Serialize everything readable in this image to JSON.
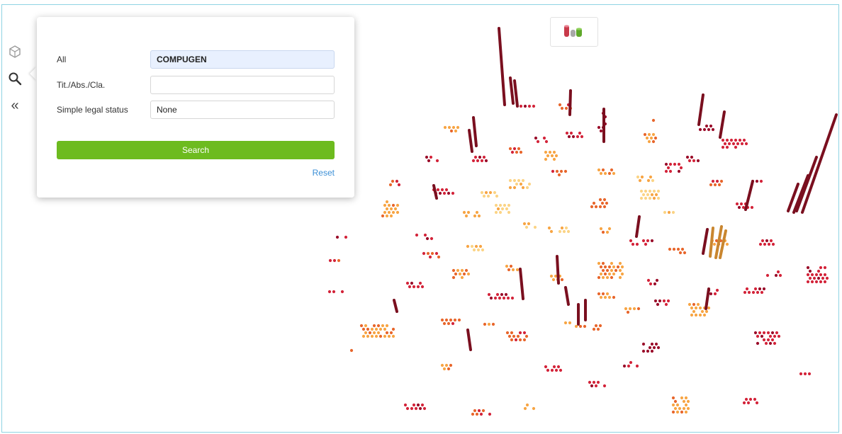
{
  "sidebar": {
    "tools": [
      {
        "name": "cube-icon"
      },
      {
        "name": "search-icon"
      },
      {
        "name": "collapse-icon",
        "glyph": "«"
      }
    ]
  },
  "search_panel": {
    "fields": [
      {
        "label": "All",
        "value": "COMPUGEN"
      },
      {
        "label": "Tit./Abs./Cla.",
        "value": ""
      },
      {
        "label": "Simple legal status",
        "value": "None"
      }
    ],
    "search_label": "Search",
    "reset_label": "Reset"
  },
  "legend_toggle": {
    "icon": "cylinders-icon"
  },
  "colors": {
    "accent_green": "#6dbb1f",
    "link_blue": "#3b8fd6",
    "frame": "#8fd3e3",
    "bar_dark_red": "#7a0f1f",
    "dot_palette": [
      "#fdf1b8",
      "#fbd486",
      "#f7a544",
      "#e8662c",
      "#d3243a",
      "#9a0c2a"
    ]
  }
}
